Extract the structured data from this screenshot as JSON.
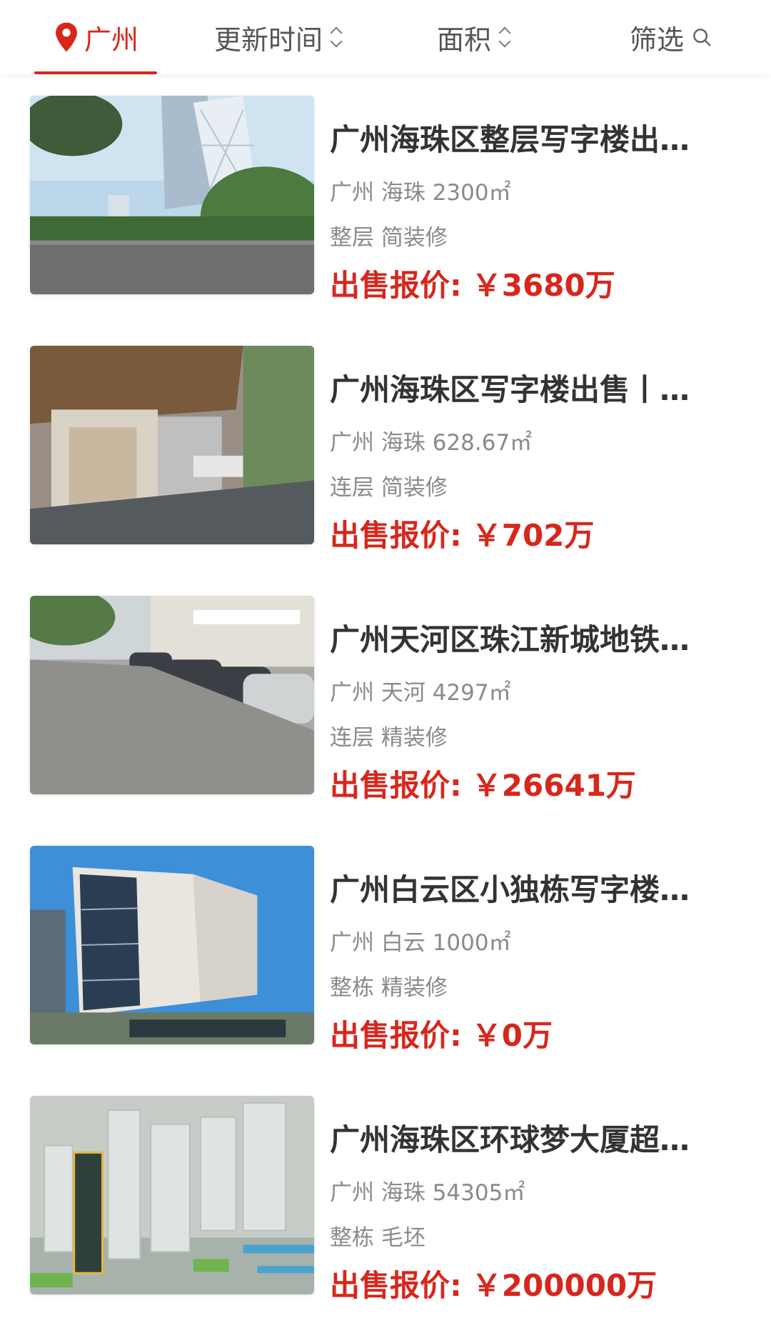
{
  "header": {
    "city": "广州",
    "sort_update": "更新时间",
    "sort_area": "面积",
    "filter": "筛选"
  },
  "colors": {
    "accent": "#d8261c"
  },
  "listings": [
    {
      "title": "广州海珠区整层写字楼出…",
      "meta1": "广州 海珠 2300㎡",
      "meta2": "整层 简装修",
      "price_label": "出售报价:",
      "price": "￥3680万"
    },
    {
      "title": "广州海珠区写字楼出售丨…",
      "meta1": "广州 海珠 628.67㎡",
      "meta2": "连层 简装修",
      "price_label": "出售报价:",
      "price": "￥702万"
    },
    {
      "title": "广州天河区珠江新城地铁…",
      "meta1": "广州 天河 4297㎡",
      "meta2": "连层 精装修",
      "price_label": "出售报价:",
      "price": "￥26641万"
    },
    {
      "title": "广州白云区小独栋写字楼…",
      "meta1": "广州 白云 1000㎡",
      "meta2": "整栋 精装修",
      "price_label": "出售报价:",
      "price": "￥0万"
    },
    {
      "title": "广州海珠区环球梦大厦超…",
      "meta1": "广州 海珠 54305㎡",
      "meta2": "整栋 毛坯",
      "price_label": "出售报价:",
      "price": "￥200000万"
    }
  ]
}
